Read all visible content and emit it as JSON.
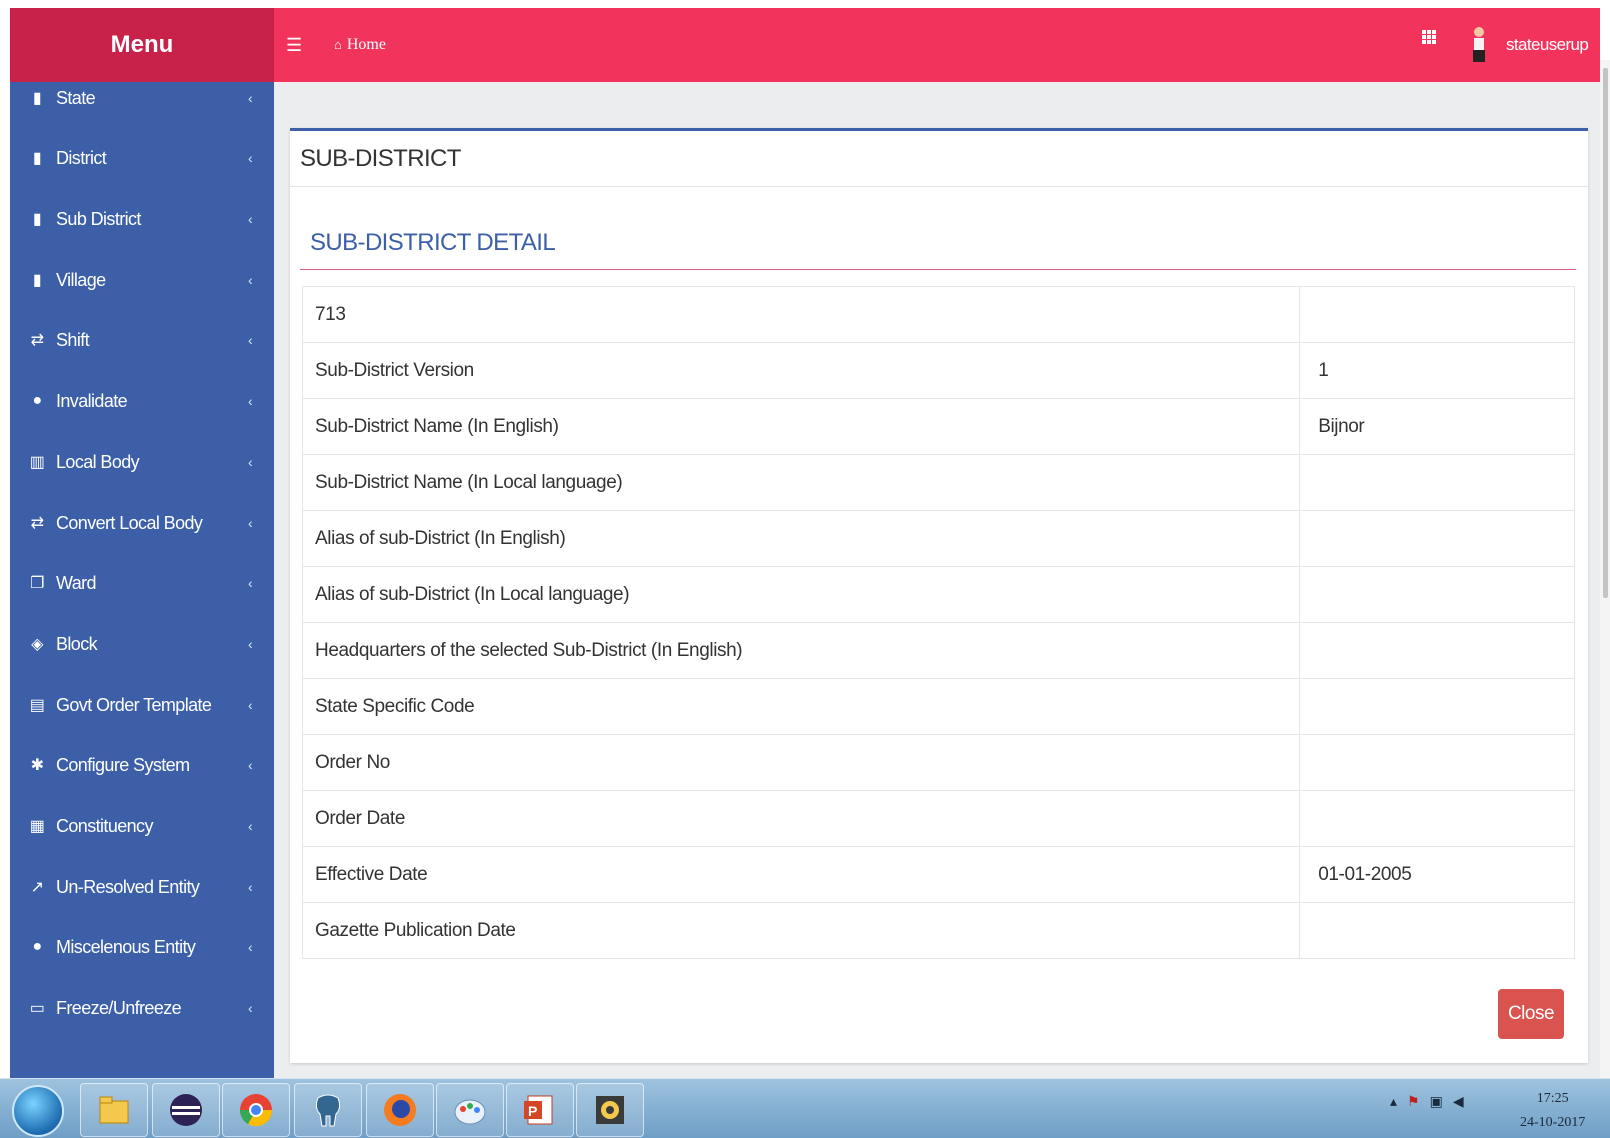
{
  "sidebar": {
    "title": "Menu",
    "items": [
      {
        "label": "State",
        "icon": "building-icon"
      },
      {
        "label": "District",
        "icon": "building-icon"
      },
      {
        "label": "Sub District",
        "icon": "building-icon"
      },
      {
        "label": "Village",
        "icon": "building-icon"
      },
      {
        "label": "Shift",
        "icon": "exchange-icon"
      },
      {
        "label": "Invalidate",
        "icon": "check-circle-icon"
      },
      {
        "label": "Local Body",
        "icon": "map-icon"
      },
      {
        "label": "Convert Local Body",
        "icon": "exchange-icon"
      },
      {
        "label": "Ward",
        "icon": "copy-icon"
      },
      {
        "label": "Block",
        "icon": "cube-icon"
      },
      {
        "label": "Govt Order Template",
        "icon": "file-icon"
      },
      {
        "label": "Configure System",
        "icon": "gear-icon"
      },
      {
        "label": "Constituency",
        "icon": "bank-icon"
      },
      {
        "label": "Un-Resolved Entity",
        "icon": "external-link-icon"
      },
      {
        "label": "Miscelenous Entity",
        "icon": "check-circle-icon"
      },
      {
        "label": "Freeze/Unfreeze",
        "icon": "laptop-icon"
      }
    ],
    "chevron": "‹"
  },
  "topbar": {
    "home_label": "Home",
    "user_name": "stateuserup"
  },
  "panel": {
    "title": "SUB-DISTRICT",
    "detail_title": "SUB-DISTRICT DETAIL",
    "rows": [
      {
        "label": "713",
        "value": ""
      },
      {
        "label": "Sub-District Version",
        "value": "1"
      },
      {
        "label": "Sub-District Name (In English)",
        "value": "Bijnor"
      },
      {
        "label": "Sub-District Name (In Local language)",
        "value": ""
      },
      {
        "label": "Alias of sub-District (In English)",
        "value": ""
      },
      {
        "label": "Alias of sub-District (In Local language)",
        "value": ""
      },
      {
        "label": "Headquarters of the selected Sub-District (In English)",
        "value": ""
      },
      {
        "label": "State Specific Code",
        "value": ""
      },
      {
        "label": "Order No",
        "value": ""
      },
      {
        "label": "Order Date",
        "value": ""
      },
      {
        "label": "Effective Date",
        "value": "01-01-2005"
      },
      {
        "label": "Gazette Publication Date",
        "value": ""
      }
    ],
    "close_label": "Close"
  },
  "taskbar": {
    "apps": [
      "explorer-icon",
      "eclipse-icon",
      "chrome-icon",
      "postgres-icon",
      "firefox-icon",
      "paint-icon",
      "powerpoint-icon",
      "app-icon"
    ],
    "time": "17:25",
    "date": "24-10-2017"
  },
  "colors": {
    "menu_header": "#c9224a",
    "topbar": "#f2345d",
    "sidebar": "#3c5fa8",
    "close_button": "#d9534f"
  }
}
